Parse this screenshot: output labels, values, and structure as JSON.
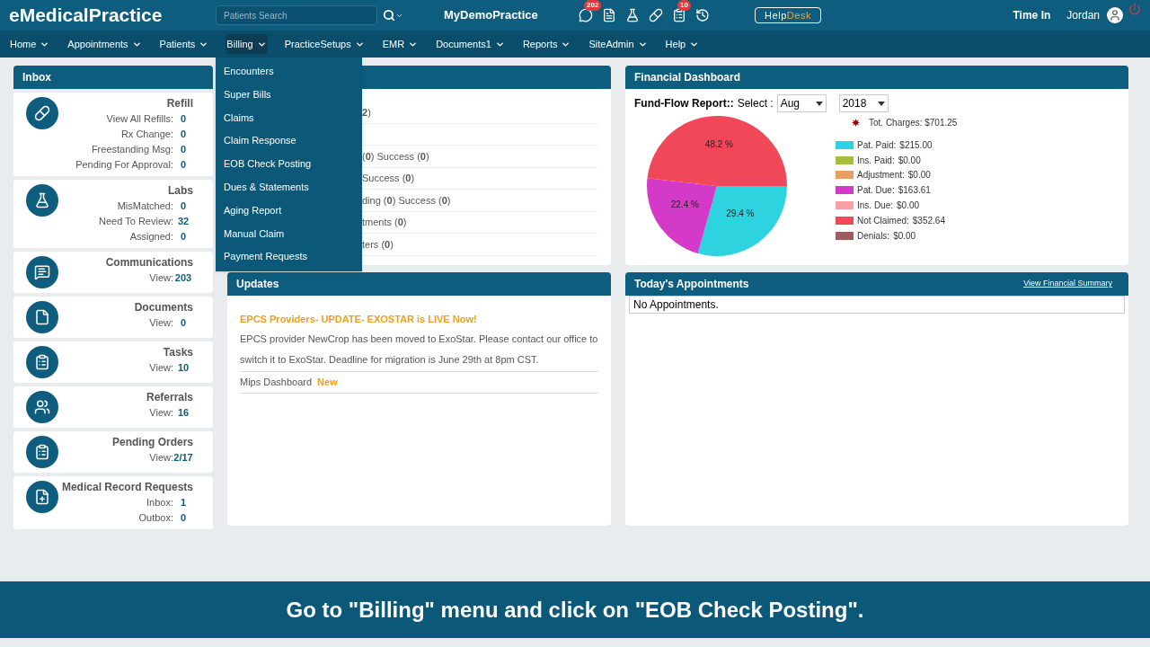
{
  "header": {
    "logo": "eMedicalPractice",
    "search": {
      "placeholder": "Patients Search"
    },
    "practice": "MyDemoPractice",
    "badges": {
      "messages": "202",
      "tasks": "10"
    },
    "helpdesk": {
      "part_1": "Help",
      "part_2": "Desk"
    },
    "time_in": "Time In",
    "user": "Jordan"
  },
  "nav": [
    {
      "label": "Home",
      "selected": false
    },
    {
      "label": "Appointments",
      "selected": false
    },
    {
      "label": "Patients",
      "selected": false
    },
    {
      "label": "Billing",
      "selected": true
    },
    {
      "label": "PracticeSetups",
      "selected": false
    },
    {
      "label": "EMR",
      "selected": false
    },
    {
      "label": "Documents1",
      "selected": false
    },
    {
      "label": "Reports",
      "selected": false
    },
    {
      "label": "SiteAdmin",
      "selected": false
    },
    {
      "label": "Help",
      "selected": false
    }
  ],
  "billing_menu": [
    "Encounters",
    "Super Bills",
    "Claims",
    "Claim Response",
    "EOB Check Posting",
    "Dues & Statements",
    "Aging Report",
    "Manual Claim",
    "Payment Requests"
  ],
  "inbox": {
    "title": "Inbox",
    "cards": [
      {
        "title": "Refill",
        "rows": [
          {
            "label": "View All Refills:",
            "value": "0"
          },
          {
            "label": "Rx Change:",
            "value": "0"
          },
          {
            "label": "Freestanding Msg:",
            "value": "0"
          },
          {
            "label": "Pending For Approval:",
            "value": "0"
          }
        ]
      },
      {
        "title": "Labs",
        "rows": [
          {
            "label": "MisMatched:",
            "value": "0"
          },
          {
            "label": "Need To Review:",
            "value": "32"
          },
          {
            "label": "Assigned:",
            "value": "0"
          }
        ]
      },
      {
        "title": "Communications",
        "rows": [
          {
            "label": "View:",
            "value": "203"
          }
        ]
      },
      {
        "title": "Documents",
        "rows": [
          {
            "label": "View:",
            "value": "0"
          }
        ]
      },
      {
        "title": "Tasks",
        "rows": [
          {
            "label": "View:",
            "value": "10"
          }
        ]
      },
      {
        "title": "Referrals",
        "rows": [
          {
            "label": "View:",
            "value": "16"
          }
        ]
      },
      {
        "title": "Pending Orders",
        "rows": [
          {
            "label": "View:",
            "value": "2/17"
          }
        ]
      },
      {
        "title": "Medical Record Requests",
        "rows": [
          {
            "label": "Inbox:",
            "value": "1"
          },
          {
            "label": "Outbox:",
            "value": "0"
          }
        ]
      }
    ]
  },
  "hidden_panel": {
    "rows": [
      "**2**)",
      "",
      "(**0**)  Success (**0**)",
      "Success (**0**)",
      "ding (**0**)  Success (**0**)",
      "tments (**0**)",
      "ters (**0**)"
    ]
  },
  "financial": {
    "title": "Financial Dashboard",
    "report_label": "Fund-Flow Report::",
    "select_label": "Select :",
    "month": "Aug",
    "year": "2018",
    "total": "Tot. Charges: $701.25",
    "legend": [
      {
        "label": "Pat. Paid:",
        "amount": "$215.00",
        "color": "#2dd4e0"
      },
      {
        "label": "Ins. Paid:",
        "amount": "$0.00",
        "color": "#a8bd3a"
      },
      {
        "label": "Adjustment:",
        "amount": "$0.00",
        "color": "#e8a060"
      },
      {
        "label": "Pat. Due:",
        "amount": "$163.61",
        "color": "#d43ac8"
      },
      {
        "label": "Ins. Due:",
        "amount": "$0.00",
        "color": "#f8a0a8"
      },
      {
        "label": "Not Claimed:",
        "amount": "$352.64",
        "color": "#f04858"
      },
      {
        "label": "Denials:",
        "amount": "$0.00",
        "color": "#a05a60"
      }
    ],
    "chart_data": {
      "type": "pie",
      "series": [
        {
          "values": [
            29.4,
            0,
            0,
            22.4,
            0,
            48.2,
            0
          ]
        }
      ],
      "value_labels": [
        "29.4 %",
        null,
        null,
        "22.4 %",
        null,
        "48.2 %",
        null
      ]
    }
  },
  "updates": {
    "title": "Updates",
    "headline": "EPCS Providers- UPDATE- EXOSTAR is LIVE Now!",
    "body": "EPCS provider NewCrop has been moved to ExoStar. Please contact our office to switch it to ExoStar. Deadline for migration is June 29th at 8pm CST.",
    "link": "Mips Dashboard",
    "link_badge": "New"
  },
  "appointments": {
    "title": "Today's Appointments",
    "link": "View Financial Summary",
    "empty": "No Appointments."
  },
  "caption": "Go to \"Billing\" menu and click on \"EOB Check Posting\"."
}
